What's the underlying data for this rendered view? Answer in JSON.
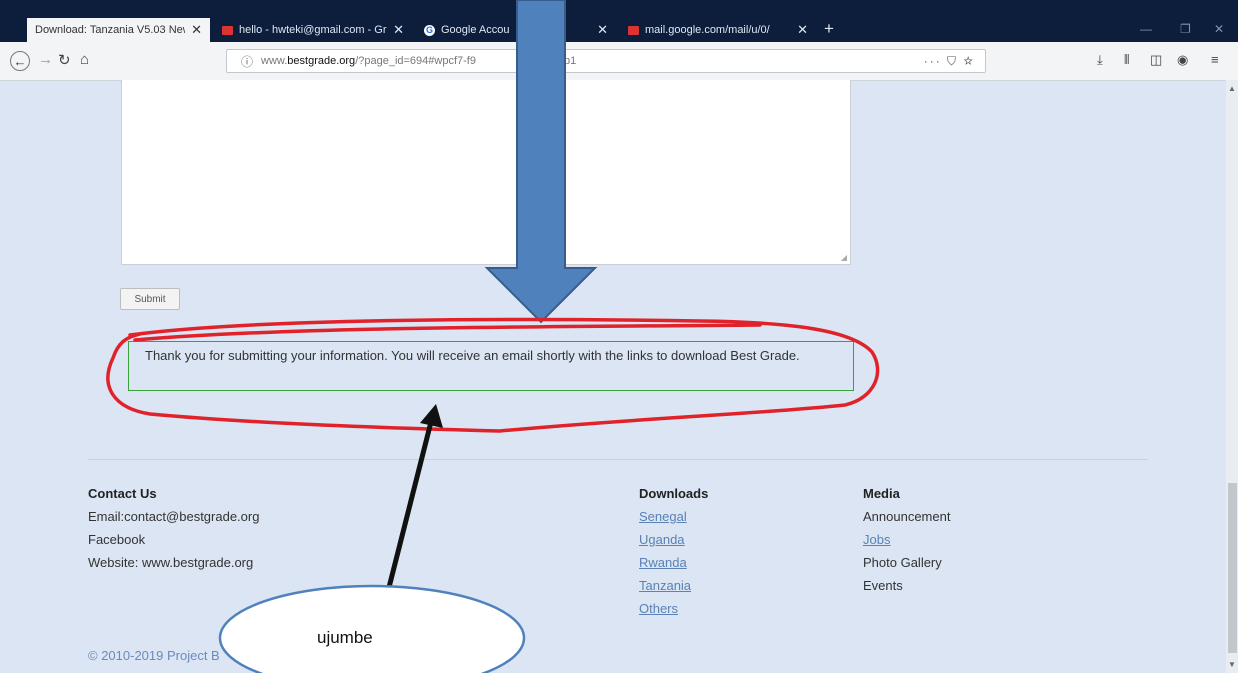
{
  "browser": {
    "tabs": [
      {
        "label": "Download: Tanzania V5.03 New",
        "icon": "page-icon",
        "active": true
      },
      {
        "label": "hello - hwteki@gmail.com - Gr",
        "icon": "gmail-icon",
        "active": false
      },
      {
        "label": "Google Accou",
        "icon": "google-icon",
        "active": false
      },
      {
        "label": "mail.google.com/mail/u/0/",
        "icon": "gmail-icon",
        "active": false
      }
    ],
    "new_tab": "+",
    "url_prefix": "www.",
    "url_domain": "bestgrade.org",
    "url_path": "/?page_id=694#wpcf7-f9",
    "url_tail": "p1",
    "url_actions": "··· ⛉ ☆"
  },
  "form": {
    "submit_label": "Submit",
    "success_message": "Thank you for submitting your information. You will receive an email shortly with the links to download Best Grade."
  },
  "footer": {
    "contact": {
      "heading": "Contact Us",
      "email": "Email:contact@bestgrade.org",
      "facebook": "Facebook",
      "website": "Website: www.bestgrade.org"
    },
    "downloads": {
      "heading": "Downloads",
      "links": [
        "Senegal",
        "Uganda",
        "Rwanda",
        "Tanzania",
        "Others"
      ]
    },
    "media": {
      "heading": "Media",
      "items": [
        {
          "label": "Announcement",
          "link": false
        },
        {
          "label": "Jobs",
          "link": true
        },
        {
          "label": "Photo Gallery",
          "link": false
        },
        {
          "label": "Events",
          "link": false
        }
      ]
    },
    "copyright": "© 2010-2019 Project B"
  },
  "annotation": {
    "callout_text": "ujumbe",
    "colors": {
      "arrow_fill": "#4f81bd",
      "arrow_stroke": "#385d8a",
      "circle": "#e0232b",
      "pointer": "#111111"
    }
  }
}
